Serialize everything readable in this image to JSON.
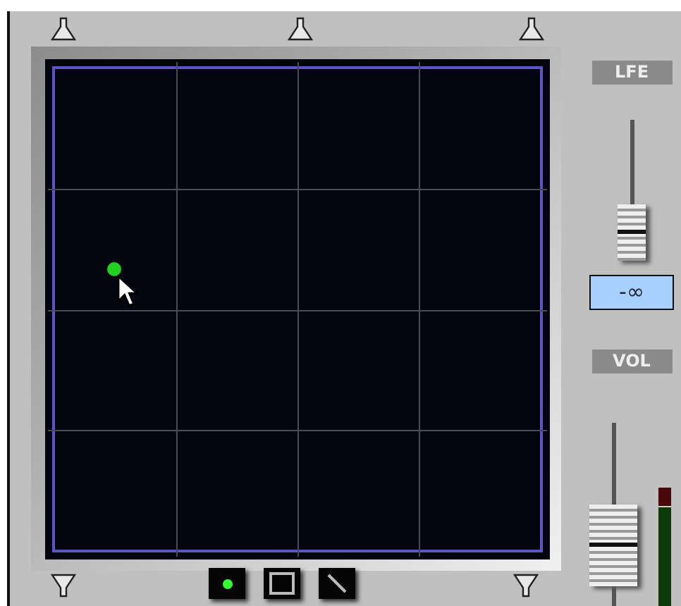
{
  "pad": {
    "modes": [
      {
        "kind": "dot"
      },
      {
        "kind": "square"
      },
      {
        "kind": "line"
      }
    ]
  },
  "lfe": {
    "label": "LFE",
    "level": 0,
    "reading": "-∞"
  },
  "volume": {
    "label": "VOL",
    "level": 0.2
  },
  "meter": {
    "level": 0.85
  }
}
